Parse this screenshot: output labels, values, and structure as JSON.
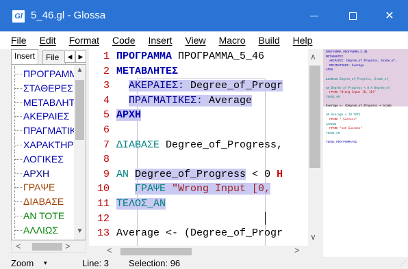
{
  "window": {
    "title": "5_46.gl - Glossa",
    "app_icon_text": "Gl",
    "close_glyph": "✕"
  },
  "menu": [
    "File",
    "Edit",
    "Format",
    "Code",
    "Insert",
    "View",
    "Macro",
    "Build",
    "Help"
  ],
  "left_panel": {
    "tabs": {
      "insert": "Insert",
      "file": "File"
    },
    "tab_prev": "◀",
    "tab_next": "▶",
    "tree_items": [
      {
        "label": "ΠΡΟΓΡΑΜΜΑ",
        "color": "#0000b0"
      },
      {
        "label": "ΣΤΑΘΕΡΕΣ",
        "color": "#0000b0"
      },
      {
        "label": "ΜΕΤΑΒΛΗΤΕΣ",
        "color": "#0000b0"
      },
      {
        "label": "ΑΚΕΡΑΙΕΣ",
        "color": "#0000b0"
      },
      {
        "label": "ΠΡΑΓΜΑΤΙΚΕΣ",
        "color": "#0000b0"
      },
      {
        "label": "ΧΑΡΑΚΤΗΡΕΣ",
        "color": "#0000b0"
      },
      {
        "label": "ΛΟΓΙΚΕΣ",
        "color": "#0000b0"
      },
      {
        "label": "ΑΡΧΗ",
        "color": "#000080"
      },
      {
        "label": "ΓΡΑΨΕ",
        "color": "#a04000"
      },
      {
        "label": "ΔΙΑΒΑΣΕ",
        "color": "#a04000"
      },
      {
        "label": "ΑΝ ΤΟΤΕ",
        "color": "#008000"
      },
      {
        "label": "ΑΛΛΙΩΣ",
        "color": "#008000"
      }
    ],
    "scroll_up": "▲",
    "scroll_down": "▼",
    "scroll_left": "<",
    "scroll_right": ">"
  },
  "editor": {
    "line_numbers": [
      "1",
      "2",
      "3",
      "4",
      "5",
      "6",
      "7",
      "8",
      "9",
      "10",
      "11",
      "12",
      "13"
    ],
    "line1_kw": "ΠΡΟΓΡΑΜΜΑ",
    "line1_name": " ΠΡΟΓΡΑΜΜΑ_5_46",
    "line2": "ΜΕΤΑΒΛΗΤΕΣ",
    "line3_kw": "ΑΚΕΡΑΙΕΣ:",
    "line3_rest": " Degree_of_Progr",
    "line4_kw": "ΠΡΑΓΜΑΤΙΚΕΣ:",
    "line4_rest": " Average",
    "line5": "ΑΡΧΗ",
    "line7_kw": "ΔΙΑΒΑΣΕ",
    "line7_rest": " Degree_of_Progress,",
    "line9_kw": "ΑΝ",
    "line9_var": "Degree_of_Progress",
    "line9_rest": " < 0 ",
    "line9_tail": "Η",
    "line10_kw": "ΓΡΑΨΕ",
    "line10_str": " \"Wrong Input [0,",
    "line11": "ΤΕΛΟΣ_ΑΝ",
    "line13": "Average <- (Degree_of_Progr",
    "fold_glyph": "⊟",
    "scroll_up": "∧",
    "scroll_down": "∨",
    "scroll_left": "<",
    "scroll_right": ">"
  },
  "minimap": {
    "lines": [
      {
        "text": "ΠΡΟΓΡΑΜΜΑ ΠΡΟΓΡΑΜΜΑ_5_46",
        "color": "#0000b0"
      },
      {
        "text": "ΜΕΤΑΒΛΗΤΕΣ",
        "color": "#0000b0"
      },
      {
        "text": "  ΑΚΕΡΑΙΕΣ: Degree_of_Progress, Grade_of_",
        "color": "#0000b0"
      },
      {
        "text": "  ΠΡΑΓΜΑΤΙΚΕΣ: Average",
        "color": "#0000b0"
      },
      {
        "text": "ΑΡΧΗ",
        "color": "#0000b0"
      },
      {
        "text": "",
        "color": "#000"
      },
      {
        "text": "ΔΙΑΒΑΣΕ Degree_of_Progress, Grade_of_",
        "color": "#008080"
      },
      {
        "text": "",
        "color": "#000"
      },
      {
        "text": "ΑΝ Degree_of_Progress < 0 Η Degree_of_",
        "color": "#008080"
      },
      {
        "text": "  ΓΡΑΨΕ \"Wrong Input [0, 10]\"",
        "color": "#c00000"
      },
      {
        "text": "ΤΕΛΟΣ_ΑΝ",
        "color": "#008080"
      },
      {
        "text": "",
        "color": "#000"
      },
      {
        "text": "Average <- (Degree_of_Progress + Grade",
        "color": "#000"
      },
      {
        "text": "",
        "color": "#000"
      },
      {
        "text": "ΑΝ Average > 10 ΤΟΤΕ",
        "color": "#008080"
      },
      {
        "text": "  ΓΡΑΨΕ \" Success\"",
        "color": "#c00000"
      },
      {
        "text": "ΑΛΛΙΩΣ",
        "color": "#008080"
      },
      {
        "text": "  ΓΡΑΨΕ \"not Success\"",
        "color": "#c00000"
      },
      {
        "text": "ΤΕΛΟΣ_ΑΝ",
        "color": "#008080"
      },
      {
        "text": "",
        "color": "#000"
      },
      {
        "text": "ΤΕΛΟΣ_ΠΡΟΓΡΑΜΜΑΤΟΣ",
        "color": "#0000b0"
      }
    ]
  },
  "status": {
    "zoom": "Zoom",
    "zoom_arrow": "▾",
    "line": "Line:  3",
    "selection": "Selection:  96",
    "grip": "⋰"
  }
}
